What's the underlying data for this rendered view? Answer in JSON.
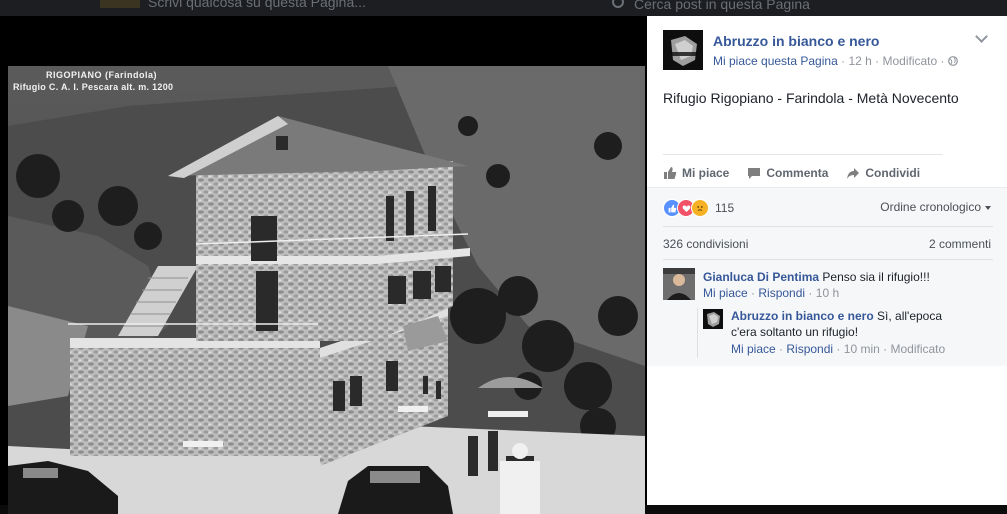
{
  "topbar": {
    "page_name": "Scrivi qualcosa su questa Pagina...",
    "search_placeholder": "Cerca post in questa Pagina"
  },
  "photo": {
    "caption_line1": "RIGOPIANO (Farindola)",
    "caption_line2": "Rifugio C. A. I. Pescara alt. m. 1200"
  },
  "post": {
    "page_name": "Abruzzo in bianco e nero",
    "avatar_text": "ABRUZZO IN BIANCO E NERO",
    "like_page": "Mi piace questa Pagina",
    "time": "12 h",
    "edited": "Modificato",
    "text": "Rifugio Rigopiano - Farindola - Metà Novecento",
    "actions": {
      "like": "Mi piace",
      "comment": "Commenta",
      "share": "Condividi"
    }
  },
  "stats": {
    "reactions_count": "115",
    "order": "Ordine cronologico",
    "shares": "326 condivisioni",
    "comments": "2 commenti"
  },
  "comments": [
    {
      "author": "Gianluca Di Pentima",
      "text": "Penso sia il rifugio!!!",
      "like": "Mi piace",
      "reply": "Rispondi",
      "time": "10 h"
    },
    {
      "author": "Abruzzo in bianco e nero",
      "text": "Sì, all'epoca c'era soltanto un rifugio!",
      "like": "Mi piace",
      "reply": "Rispondi",
      "time": "10 min",
      "edited": "Modificato"
    }
  ],
  "colors": {
    "link": "#365899",
    "muted": "#90949c",
    "like_blue": "#5890ff",
    "love_red": "#f25268",
    "sad_yellow": "#f7b125"
  }
}
